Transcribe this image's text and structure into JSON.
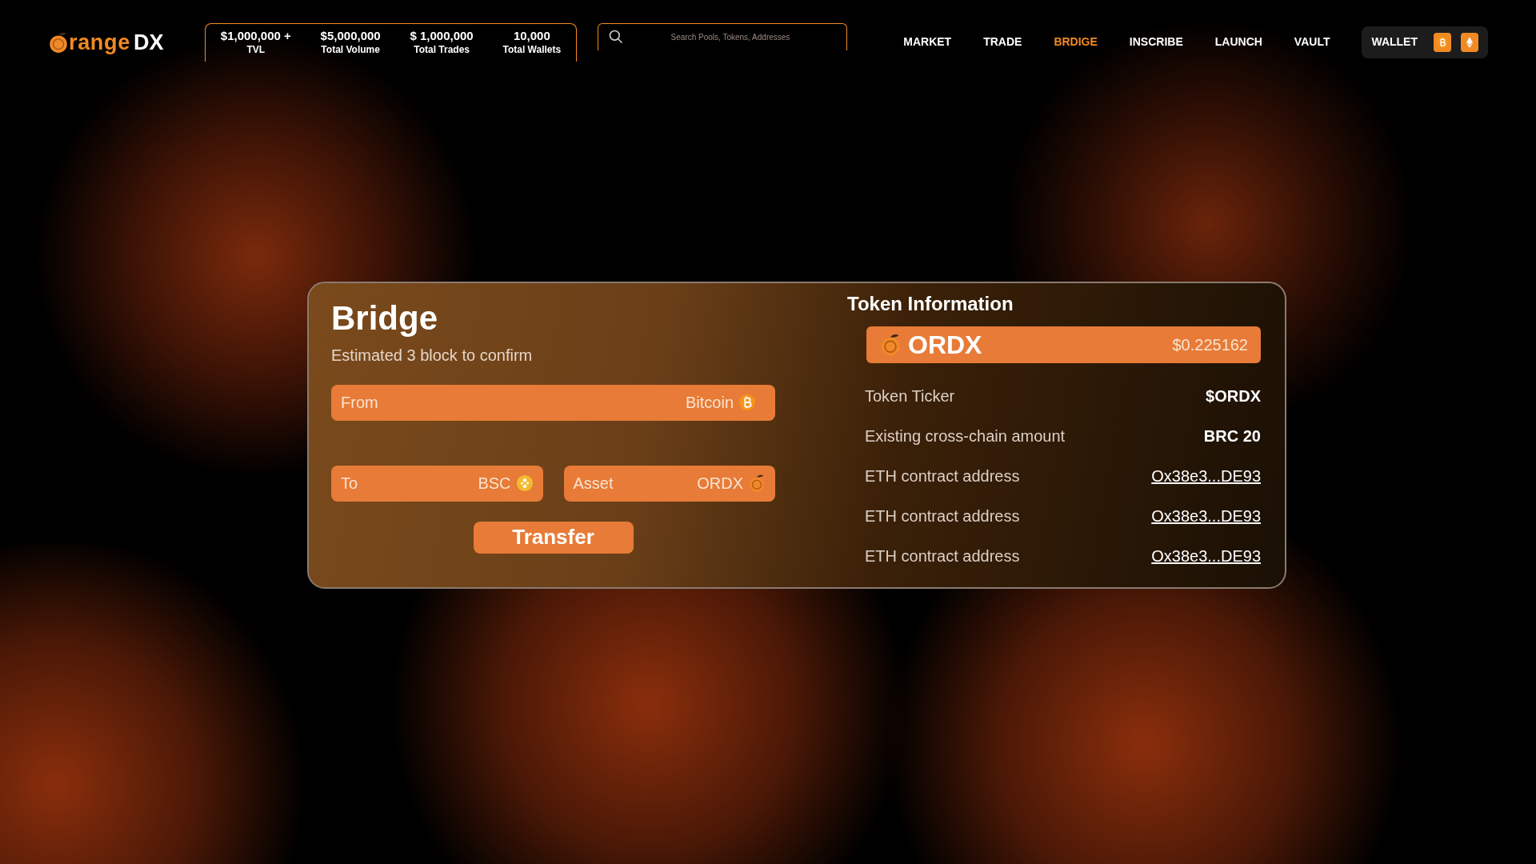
{
  "logo": {
    "text": "range",
    "suffix": "DX"
  },
  "stats": [
    {
      "value": "$1,000,000 +",
      "label": "TVL"
    },
    {
      "value": "$5,000,000",
      "label": "Total Volume"
    },
    {
      "value": "$ 1,000,000",
      "label": "Total Trades"
    },
    {
      "value": "10,000",
      "label": "Total Wallets"
    }
  ],
  "search": {
    "placeholder": "Search Pools, Tokens, Addresses"
  },
  "nav": [
    {
      "label": "MARKET",
      "selected": false
    },
    {
      "label": "TRADE",
      "selected": false
    },
    {
      "label": "BRDIGE",
      "selected": true
    },
    {
      "label": "INSCRIBE",
      "selected": false
    },
    {
      "label": "LAUNCH",
      "selected": false
    },
    {
      "label": "VAULT",
      "selected": false
    }
  ],
  "wallet": {
    "label": "WALLET"
  },
  "bridge": {
    "title": "Bridge",
    "subtitle": "Estimated 3 block to confirm",
    "from": {
      "label": "From",
      "value": "Bitcoin"
    },
    "to": {
      "label": "To",
      "value": "BSC"
    },
    "asset": {
      "label": "Asset",
      "value": "ORDX"
    },
    "button": "Transfer"
  },
  "token_info": {
    "title": "Token Information",
    "name": "ORDX",
    "price": "$0.225162",
    "rows": [
      {
        "kind": "text",
        "label": "Token Ticker",
        "value": "$ORDX"
      },
      {
        "kind": "text",
        "label": "Existing cross-chain amount",
        "value": "BRC 20"
      },
      {
        "kind": "link",
        "label": "ETH contract address",
        "value": "Ox38e3...DE93"
      },
      {
        "kind": "link",
        "label": "ETH contract address",
        "value": "Ox38e3...DE93"
      },
      {
        "kind": "link",
        "label": "ETH contract address",
        "value": "Ox38e3...DE93"
      }
    ]
  }
}
